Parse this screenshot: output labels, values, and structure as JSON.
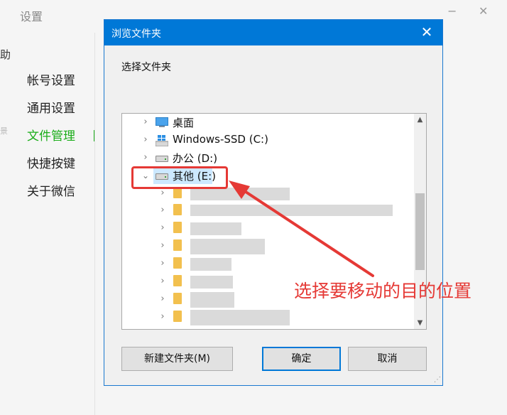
{
  "background_window": {
    "title": "设置",
    "minimize_symbol": "−",
    "close_symbol": "✕",
    "left_stub_text": "助",
    "left_stub_text2": "景"
  },
  "sidebar": {
    "items": [
      {
        "label": "帐号设置"
      },
      {
        "label": "通用设置"
      },
      {
        "label": "文件管理"
      },
      {
        "label": "快捷按键"
      },
      {
        "label": "关于微信"
      }
    ],
    "active_index": 2,
    "accent_color": "#1aad19"
  },
  "dialog": {
    "title": "浏览文件夹",
    "close_symbol": "✕",
    "instruction": "选择文件夹",
    "tree": [
      {
        "label": "桌面",
        "icon": "desktop-icon",
        "expanded": false
      },
      {
        "label": "Windows-SSD (C:)",
        "icon": "windows-drive-icon",
        "expanded": false
      },
      {
        "label": "办公 (D:)",
        "icon": "drive-icon",
        "expanded": false
      },
      {
        "label": "其他 (E:)",
        "icon": "drive-icon",
        "expanded": true,
        "selected": true
      }
    ],
    "subfolder_count": 8,
    "buttons": {
      "new_folder": "新建文件夹(M)",
      "ok": "确定",
      "cancel": "取消"
    },
    "accent_color": "#0078d7"
  },
  "annotation": {
    "text": "选择要移动的目的位置",
    "color": "#e53935"
  }
}
